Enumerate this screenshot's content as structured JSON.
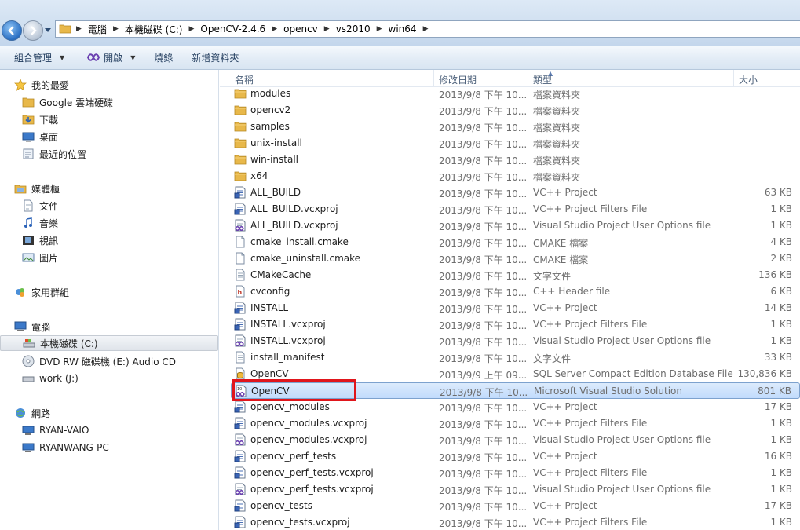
{
  "address": {
    "crumbs": [
      "電腦",
      "本機磁碟 (C:)",
      "OpenCV-2.4.6",
      "opencv",
      "vs2010",
      "win64"
    ]
  },
  "toolbar": {
    "organize": "組合管理",
    "open": "開啟",
    "burn": "燒錄",
    "new_folder": "新增資料夾"
  },
  "nav": {
    "favorites": "我的最愛",
    "google_drive": "Google 雲端硬碟",
    "downloads": "下載",
    "desktop": "桌面",
    "recent": "最近的位置",
    "libraries": "媒體櫃",
    "documents": "文件",
    "music": "音樂",
    "videos": "視訊",
    "pictures": "圖片",
    "homegroup": "家用群組",
    "computer": "電腦",
    "local_disk": "本機磁碟 (C:)",
    "dvd": "DVD RW 磁碟機 (E:) Audio CD",
    "work": "work (J:)",
    "network": "網路",
    "ryan_vaio": "RYAN-VAIO",
    "ryanwang_pc": "RYANWANG-PC"
  },
  "columns": {
    "name": "名稱",
    "date": "修改日期",
    "type": "類型",
    "size": "大小"
  },
  "files": [
    {
      "name": "modules",
      "date": "2013/9/8 下午 10...",
      "type": "檔案資料夾",
      "size": "",
      "icon": "folder-icon"
    },
    {
      "name": "opencv2",
      "date": "2013/9/8 下午 10...",
      "type": "檔案資料夾",
      "size": "",
      "icon": "folder-icon"
    },
    {
      "name": "samples",
      "date": "2013/9/8 下午 10...",
      "type": "檔案資料夾",
      "size": "",
      "icon": "folder-icon"
    },
    {
      "name": "unix-install",
      "date": "2013/9/8 下午 10...",
      "type": "檔案資料夾",
      "size": "",
      "icon": "folder-icon"
    },
    {
      "name": "win-install",
      "date": "2013/9/8 下午 10...",
      "type": "檔案資料夾",
      "size": "",
      "icon": "folder-icon"
    },
    {
      "name": "x64",
      "date": "2013/9/8 下午 10...",
      "type": "檔案資料夾",
      "size": "",
      "icon": "folder-icon"
    },
    {
      "name": "ALL_BUILD",
      "date": "2013/9/8 下午 10...",
      "type": "VC++ Project",
      "size": "63 KB",
      "icon": "vcproj-icon"
    },
    {
      "name": "ALL_BUILD.vcxproj",
      "date": "2013/9/8 下午 10...",
      "type": "VC++ Project Filters File",
      "size": "1 KB",
      "icon": "vcproj-icon"
    },
    {
      "name": "ALL_BUILD.vcxproj",
      "date": "2013/9/8 下午 10...",
      "type": "Visual Studio Project User Options file",
      "size": "1 KB",
      "icon": "vs-options-icon"
    },
    {
      "name": "cmake_install.cmake",
      "date": "2013/9/8 下午 10...",
      "type": "CMAKE 檔案",
      "size": "4 KB",
      "icon": "file-icon"
    },
    {
      "name": "cmake_uninstall.cmake",
      "date": "2013/9/8 下午 10...",
      "type": "CMAKE 檔案",
      "size": "2 KB",
      "icon": "file-icon"
    },
    {
      "name": "CMakeCache",
      "date": "2013/9/8 下午 10...",
      "type": "文字文件",
      "size": "136 KB",
      "icon": "text-file-icon"
    },
    {
      "name": "cvconfig",
      "date": "2013/9/8 下午 10...",
      "type": "C++ Header file",
      "size": "6 KB",
      "icon": "header-file-icon"
    },
    {
      "name": "INSTALL",
      "date": "2013/9/8 下午 10...",
      "type": "VC++ Project",
      "size": "14 KB",
      "icon": "vcproj-icon"
    },
    {
      "name": "INSTALL.vcxproj",
      "date": "2013/9/8 下午 10...",
      "type": "VC++ Project Filters File",
      "size": "1 KB",
      "icon": "vcproj-icon"
    },
    {
      "name": "INSTALL.vcxproj",
      "date": "2013/9/8 下午 10...",
      "type": "Visual Studio Project User Options file",
      "size": "1 KB",
      "icon": "vs-options-icon"
    },
    {
      "name": "install_manifest",
      "date": "2013/9/8 下午 10...",
      "type": "文字文件",
      "size": "33 KB",
      "icon": "text-file-icon"
    },
    {
      "name": "OpenCV",
      "date": "2013/9/9 上午 09...",
      "type": "SQL Server Compact Edition Database File",
      "size": "130,836 KB",
      "icon": "database-icon"
    },
    {
      "name": "OpenCV",
      "date": "2013/9/8 下午 10...",
      "type": "Microsoft Visual Studio Solution",
      "size": "801 KB",
      "icon": "vs-solution-icon"
    },
    {
      "name": "opencv_modules",
      "date": "2013/9/8 下午 10...",
      "type": "VC++ Project",
      "size": "17 KB",
      "icon": "vcproj-icon"
    },
    {
      "name": "opencv_modules.vcxproj",
      "date": "2013/9/8 下午 10...",
      "type": "VC++ Project Filters File",
      "size": "1 KB",
      "icon": "vcproj-icon"
    },
    {
      "name": "opencv_modules.vcxproj",
      "date": "2013/9/8 下午 10...",
      "type": "Visual Studio Project User Options file",
      "size": "1 KB",
      "icon": "vs-options-icon"
    },
    {
      "name": "opencv_perf_tests",
      "date": "2013/9/8 下午 10...",
      "type": "VC++ Project",
      "size": "16 KB",
      "icon": "vcproj-icon"
    },
    {
      "name": "opencv_perf_tests.vcxproj",
      "date": "2013/9/8 下午 10...",
      "type": "VC++ Project Filters File",
      "size": "1 KB",
      "icon": "vcproj-icon"
    },
    {
      "name": "opencv_perf_tests.vcxproj",
      "date": "2013/9/8 下午 10...",
      "type": "Visual Studio Project User Options file",
      "size": "1 KB",
      "icon": "vs-options-icon"
    },
    {
      "name": "opencv_tests",
      "date": "2013/9/8 下午 10...",
      "type": "VC++ Project",
      "size": "17 KB",
      "icon": "vcproj-icon"
    },
    {
      "name": "opencv_tests.vcxproj",
      "date": "2013/9/8 下午 10...",
      "type": "VC++ Project Filters File",
      "size": "1 KB",
      "icon": "vcproj-icon"
    }
  ],
  "selected_file": "OpenCV.sln",
  "colors": {
    "selection": "#c1dbfc",
    "highlight_box": "#e0161c",
    "folder": "#e8b84a"
  }
}
